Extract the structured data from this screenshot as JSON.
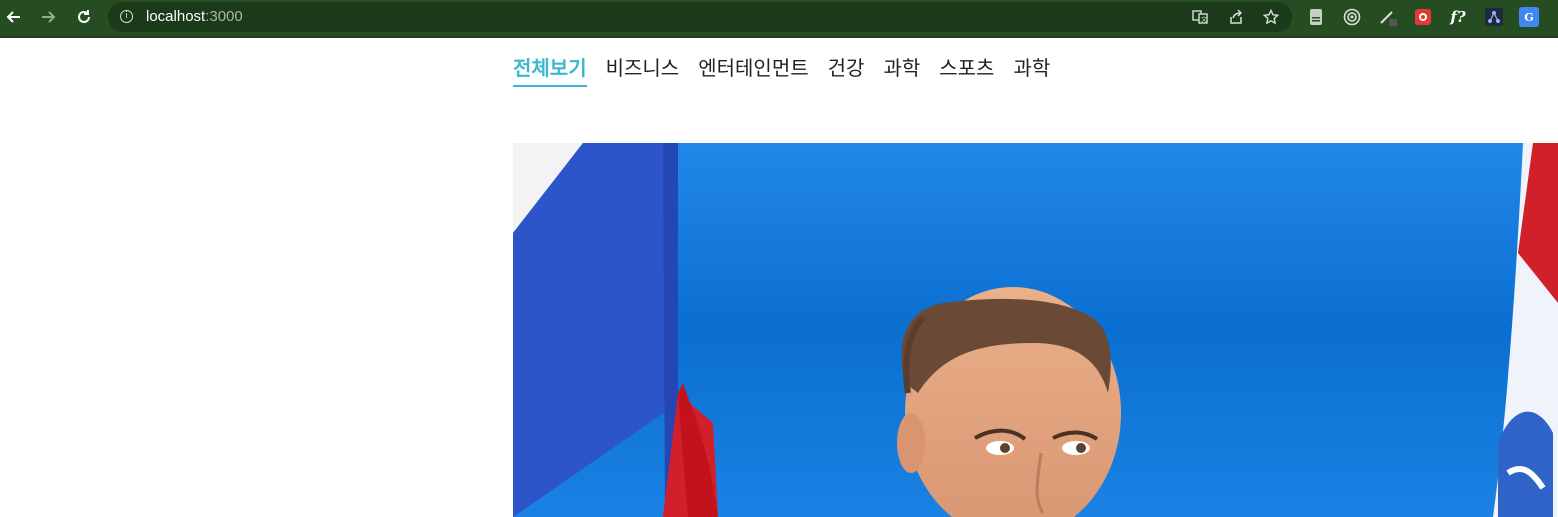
{
  "browser": {
    "url_host": "localhost",
    "url_port": ":3000",
    "icons": {
      "back": "arrow-left-icon",
      "forward": "arrow-right-icon",
      "reload": "reload-icon",
      "site_info": "info-icon",
      "translate": "translate-icon",
      "share": "share-icon",
      "bookmark": "star-icon"
    },
    "extensions": [
      {
        "name": "reader-extension-icon"
      },
      {
        "name": "target-extension-icon"
      },
      {
        "name": "pen-extension-icon"
      },
      {
        "name": "red-extension-icon"
      },
      {
        "name": "function-extension-icon",
        "glyph": "f?"
      },
      {
        "name": "network-extension-icon"
      },
      {
        "name": "google-translate-extension-icon",
        "glyph": "G"
      }
    ]
  },
  "categories": [
    {
      "label": "전체보기",
      "active": true
    },
    {
      "label": "비즈니스",
      "active": false
    },
    {
      "label": "엔터테인먼트",
      "active": false
    },
    {
      "label": "건강",
      "active": false
    },
    {
      "label": "과학",
      "active": false
    },
    {
      "label": "스포츠",
      "active": false
    },
    {
      "label": "과학",
      "active": false
    }
  ],
  "colors": {
    "accent": "#3bb8cf",
    "toolbar": "#264d22",
    "hero_background": "#0b74d6"
  }
}
